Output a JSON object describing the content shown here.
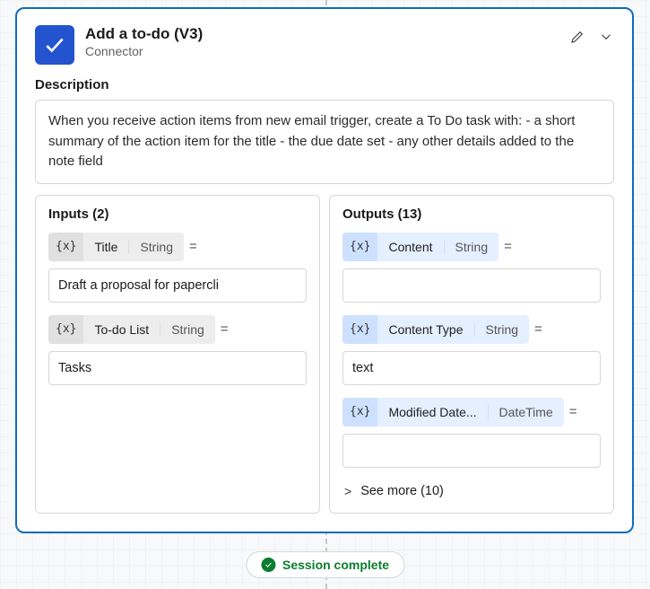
{
  "header": {
    "title": "Add a to-do (V3)",
    "subtitle": "Connector"
  },
  "description": {
    "label": "Description",
    "text": "When you receive action items from new email trigger, create a To Do task with: - a short summary of the action item for the title - the due date set - any other details added to the note field"
  },
  "inputs": {
    "title": "Inputs (2)",
    "items": [
      {
        "varbadge": "{x}",
        "name": "Title",
        "type": "String",
        "equals": "=",
        "value": "Draft a proposal for papercli"
      },
      {
        "varbadge": "{x}",
        "name": "To-do List",
        "type": "String",
        "equals": "=",
        "value": "Tasks"
      }
    ]
  },
  "outputs": {
    "title": "Outputs (13)",
    "items": [
      {
        "varbadge": "{x}",
        "name": "Content",
        "type": "String",
        "equals": "=",
        "value": ""
      },
      {
        "varbadge": "{x}",
        "name": "Content Type",
        "type": "String",
        "equals": "=",
        "value": "text"
      },
      {
        "varbadge": "{x}",
        "name": "Modified Date...",
        "type": "DateTime",
        "equals": "=",
        "value": ""
      }
    ],
    "see_more_caret": ">",
    "see_more": "See more (10)"
  },
  "session": {
    "label": "Session complete"
  }
}
